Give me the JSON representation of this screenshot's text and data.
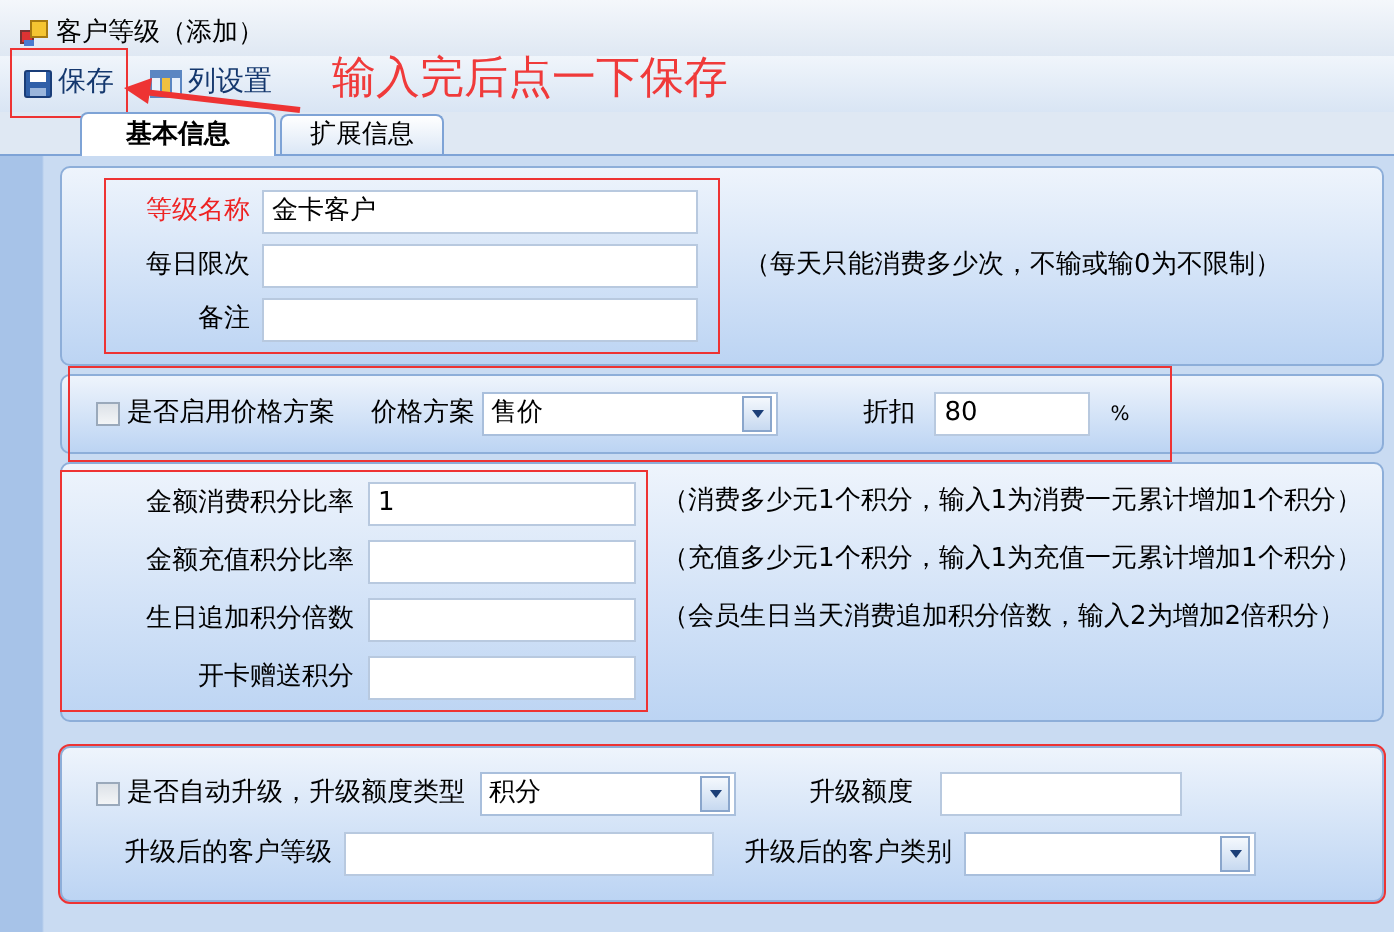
{
  "window": {
    "title": "客户等级（添加）"
  },
  "toolbar": [
    {
      "kind": "save",
      "label": "保存",
      "highlighted": true
    },
    {
      "kind": "columns",
      "label": "列设置"
    }
  ],
  "annotation": {
    "text": "输入完后点一下保存"
  },
  "tabs": [
    {
      "label": "基本信息",
      "selected": true
    },
    {
      "label": "扩展信息",
      "selected": false
    }
  ],
  "sections": [
    {
      "kind": "fields",
      "highlighted": true,
      "note": "（每天只能消费多少次，不输或输0为不限制）",
      "rows": [
        {
          "label": "等级名称",
          "required": true,
          "value": "金卡客户"
        },
        {
          "label": "每日限次",
          "required": false
        },
        {
          "label": "备注",
          "required": false
        }
      ]
    },
    {
      "kind": "pricing",
      "highlighted": true,
      "checkbox": {
        "label": "是否启用价格方案",
        "checked": false
      },
      "scheme": {
        "label": "价格方案",
        "value": "售价"
      },
      "discount": {
        "label": "折扣",
        "value": "80",
        "unit": "%"
      }
    },
    {
      "kind": "points",
      "highlighted": true,
      "rows": [
        {
          "label": "金额消费积分比率",
          "value": "1",
          "note": "（消费多少元1个积分，输入1为消费一元累计增加1个积分）"
        },
        {
          "label": "金额充值积分比率",
          "note": "（充值多少元1个积分，输入1为充值一元累计增加1个积分）"
        },
        {
          "label": "生日追加积分倍数",
          "note": "（会员生日当天消费追加积分倍数，输入2为增加2倍积分）"
        },
        {
          "label": "开卡赠送积分"
        }
      ]
    },
    {
      "kind": "upgrade",
      "highlighted": true,
      "checkbox": {
        "label": "是否自动升级，升级额度类型",
        "checked": false
      },
      "type": {
        "value": "积分"
      },
      "amount": {
        "label": "升级额度"
      },
      "level": {
        "label": "升级后的客户等级"
      },
      "category": {
        "label": "升级后的客户类别"
      }
    }
  ]
}
